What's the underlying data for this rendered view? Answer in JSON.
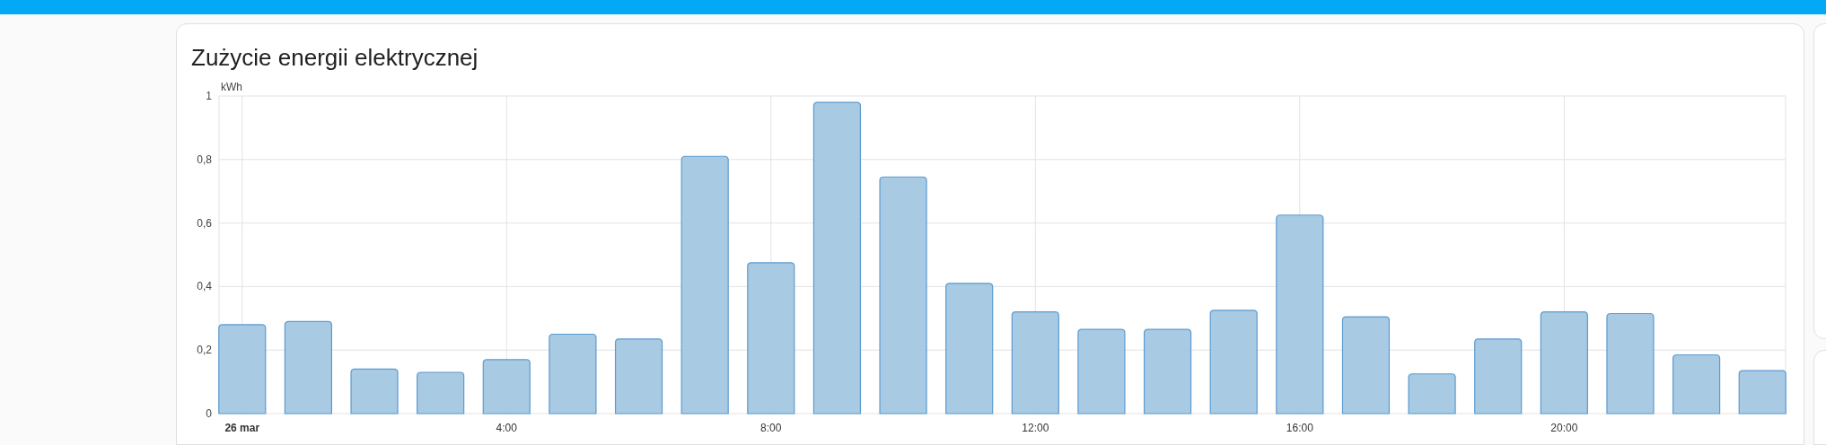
{
  "card": {
    "title": "Zużycie energii elektrycznej",
    "chart_data": {
      "type": "bar",
      "ylabel": "kWh",
      "grid": true,
      "x": [
        0,
        1,
        2,
        3,
        4,
        5,
        6,
        7,
        8,
        9,
        10,
        11,
        12,
        13,
        14,
        15,
        16,
        17,
        18,
        19,
        20,
        21,
        22,
        23
      ],
      "series": [
        {
          "color": "#a4c7e1",
          "values": [
            0.28,
            0.29,
            0.14,
            0.13,
            0.17,
            0.25,
            0.235,
            0.81,
            0.475,
            0.98,
            0.745,
            0.41,
            0.32,
            0.265,
            0.265,
            0.325,
            0.625,
            0.305,
            0.125,
            0.235,
            0.32,
            0.315,
            0.185,
            0.135
          ]
        }
      ],
      "xlim": [
        -0.35,
        23.35
      ],
      "ylim": [
        0,
        1
      ],
      "yticks": [
        {
          "value": 0,
          "label": "0"
        },
        {
          "value": 0.2,
          "label": "0,2"
        },
        {
          "value": 0.4,
          "label": "0,4"
        },
        {
          "value": 0.6,
          "label": "0,6"
        },
        {
          "value": 0.8,
          "label": "0,8"
        },
        {
          "value": 1,
          "label": "1"
        }
      ],
      "xticks": [
        {
          "value": 0,
          "label": "26 mar"
        },
        {
          "value": 4,
          "label": "4:00"
        },
        {
          "value": 8,
          "label": "8:00"
        },
        {
          "value": 12,
          "label": "12:00"
        },
        {
          "value": 16,
          "label": "16:00"
        },
        {
          "value": 20,
          "label": "20:00"
        }
      ]
    }
  }
}
